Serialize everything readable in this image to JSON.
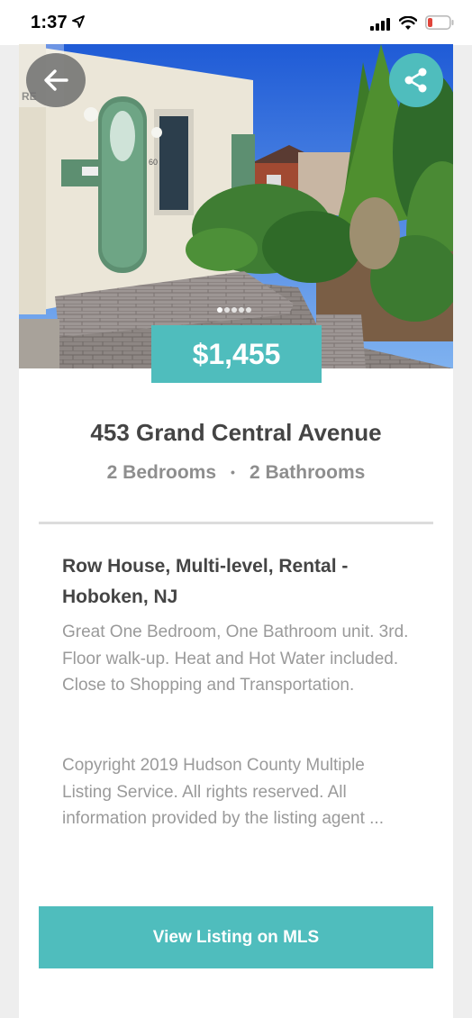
{
  "status_bar": {
    "time": "1:37",
    "icons": [
      "location-arrow-icon",
      "cellular-signal-icon",
      "wifi-icon",
      "battery-low-icon"
    ]
  },
  "listing": {
    "photo_count": 5,
    "current_photo": 1,
    "price": "$1,455",
    "address": "453 Grand Central Avenue",
    "bedrooms": "2 Bedrooms",
    "separator": "•",
    "bathrooms": "2 Bathrooms",
    "property_type": "Row House, Multi-level, Rental - Hoboken, NJ",
    "description": "Great One Bedroom, One Bathroom unit. 3rd. Floor walk-up. Heat and Hot Water included. Close to Shopping and Transportation.",
    "copyright": "Copyright 2019 Hudson County Multiple Listing Service. All rights reserved. All information provided by the listing agent ...",
    "watermark": "RE",
    "house_number": "60"
  },
  "actions": {
    "back_icon": "back-arrow-icon",
    "share_icon": "share-icon",
    "view_mls_label": "View Listing on MLS"
  },
  "colors": {
    "accent": "#4fbdbd",
    "background": "#eeeeee",
    "card": "#ffffff",
    "battery_low": "#e0443a"
  }
}
